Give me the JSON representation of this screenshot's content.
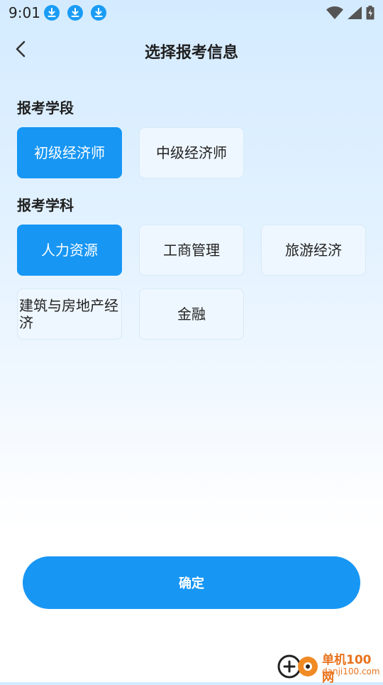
{
  "status_bar": {
    "time": "9:01",
    "download_icons": 3
  },
  "header": {
    "title": "选择报考信息"
  },
  "stage_section": {
    "label": "报考学段",
    "options": [
      {
        "label": "初级经济师",
        "selected": true
      },
      {
        "label": "中级经济师",
        "selected": false
      }
    ]
  },
  "subject_section": {
    "label": "报考学科",
    "options": [
      {
        "label": "人力资源",
        "selected": true
      },
      {
        "label": "工商管理",
        "selected": false
      },
      {
        "label": "旅游经济",
        "selected": false
      },
      {
        "label": "建筑与房地产经济",
        "selected": false
      },
      {
        "label": "金融",
        "selected": false
      }
    ]
  },
  "confirm_label": "确定",
  "watermark": {
    "site": "单机100网",
    "domain": "danji100.com"
  },
  "colors": {
    "accent": "#1796f4",
    "chip_bg": "#eef7ff",
    "chip_border": "#d8e9f7"
  }
}
